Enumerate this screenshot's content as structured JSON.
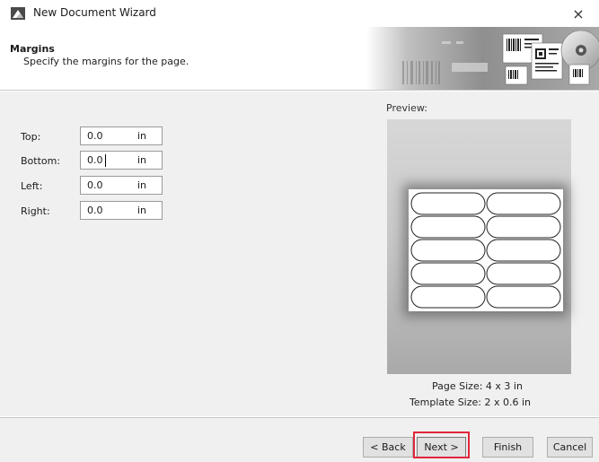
{
  "window": {
    "title": "New Document Wizard",
    "close_glyph": "×"
  },
  "header": {
    "title": "Margins",
    "subtitle": "Specify the margins for the page."
  },
  "margins": {
    "fields": [
      {
        "label": "Top:",
        "value": "0.0",
        "unit": "in"
      },
      {
        "label": "Bottom:",
        "value": "0.0",
        "unit": "in"
      },
      {
        "label": "Left:",
        "value": "0.0",
        "unit": "in"
      },
      {
        "label": "Right:",
        "value": "0.0",
        "unit": "in"
      }
    ],
    "focused_field": "Bottom:"
  },
  "preview": {
    "label": "Preview:",
    "label_grid": {
      "columns": 2,
      "rows": 5
    },
    "page_size": "Page Size:  4 x 3 in",
    "template_size": "Template Size:  2 x 0.6 in"
  },
  "buttons": {
    "back": "< Back",
    "next": "Next >",
    "finish": "Finish",
    "cancel": "Cancel"
  },
  "colors": {
    "highlight": "#e0263b"
  }
}
